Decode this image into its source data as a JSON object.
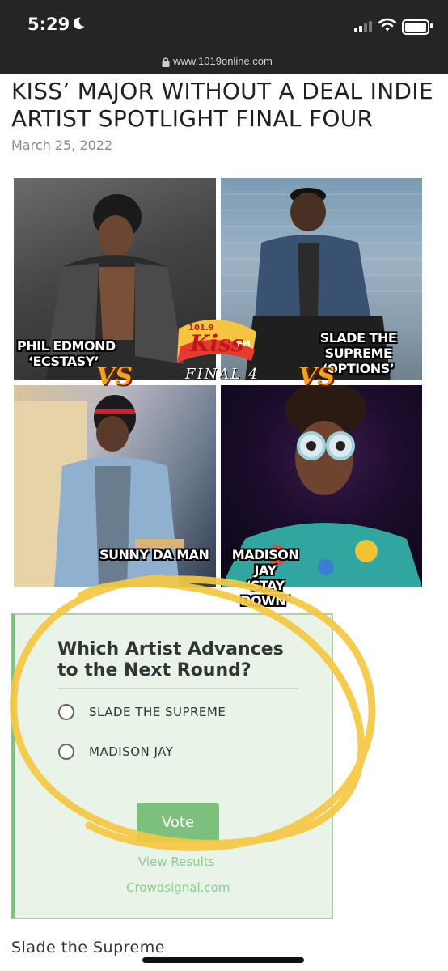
{
  "status_bar": {
    "time": "5:29"
  },
  "browser": {
    "url": "www.1019online.com"
  },
  "article": {
    "title": "KISS’ MAJOR WITHOUT A DEAL INDIE ARTIST SPOTLIGHT FINAL FOUR",
    "date": "March 25, 2022",
    "next_heading": "Slade the Supreme"
  },
  "image": {
    "artists": [
      {
        "name": "PHIL EDMOND",
        "song": "‘ECSTASY’"
      },
      {
        "name": "SLADE THE SUPREME",
        "song": "‘OPTIONS’"
      },
      {
        "name": "SUNNY DA MAN",
        "song": ""
      },
      {
        "name": "MADISON JAY",
        "song": "‘STAY DOWN’"
      }
    ],
    "vs_label": "VS",
    "logo_text": "KISS",
    "logo_freq": "101.9",
    "logo_fm": "FM",
    "final_label": "FINAL 4"
  },
  "poll": {
    "question": "Which Artist Advances to the Next Round?",
    "options": [
      "SLADE THE SUPREME",
      "MADISON JAY"
    ],
    "vote_label": "Vote",
    "results_label": "View Results",
    "powered_by": "Crowdsignal.com"
  },
  "colors": {
    "highlight": "#f5c842",
    "poll_bg": "#e9f4e9",
    "vote_button": "#7cc07c"
  }
}
